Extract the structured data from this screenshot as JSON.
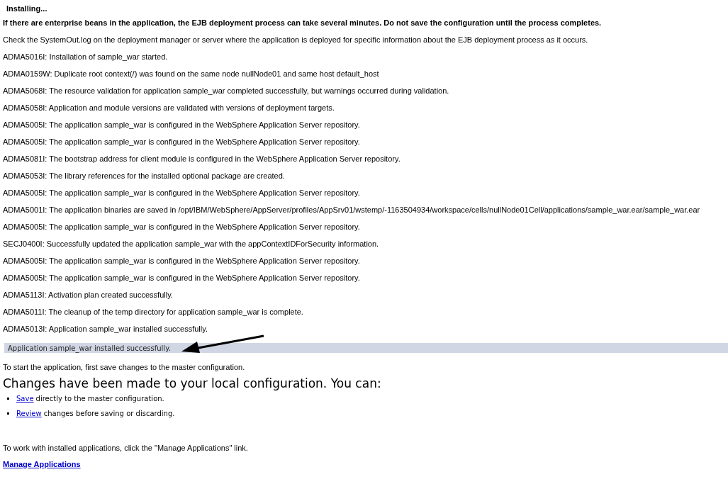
{
  "title": "Installing...",
  "warning": "If there are enterprise beans in the application, the EJB deployment process can take several minutes. Do not save the configuration until the process completes.",
  "hint": "Check the SystemOut.log on the deployment manager or server where the application is deployed for specific information about the EJB deployment process as it occurs.",
  "messages": [
    "ADMA5016I: Installation of sample_war started.",
    "ADMA0159W: Duplicate root context(/) was found on the same node nullNode01 and same host default_host",
    "ADMA5068I: The resource validation for application sample_war completed successfully, but warnings occurred during validation.",
    "ADMA5058I: Application and module versions are validated with versions of deployment targets.",
    "ADMA5005I: The application sample_war is configured in the WebSphere Application Server repository.",
    "ADMA5005I: The application sample_war is configured in the WebSphere Application Server repository.",
    "ADMA5081I: The bootstrap address for client module is configured in the WebSphere Application Server repository.",
    "ADMA5053I: The library references for the installed optional package are created.",
    "ADMA5005I: The application sample_war is configured in the WebSphere Application Server repository.",
    "ADMA5001I: The application binaries are saved in /opt/IBM/WebSphere/AppServer/profiles/AppSrv01/wstemp/-1163504934/workspace/cells/nullNode01Cell/applications/sample_war.ear/sample_war.ear",
    "ADMA5005I: The application sample_war is configured in the WebSphere Application Server repository.",
    "SECJ0400I: Successfully updated the application sample_war with the appContextIDForSecurity information.",
    "ADMA5005I: The application sample_war is configured in the WebSphere Application Server repository.",
    "ADMA5005I: The application sample_war is configured in the WebSphere Application Server repository.",
    "ADMA5113I: Activation plan created successfully.",
    "ADMA5011I: The cleanup of the temp directory for application sample_war is complete.",
    "ADMA5013I: Application sample_war installed successfully."
  ],
  "success_banner": "Application sample_war installed successfully.",
  "start_note": "To start the application, first save changes to the master configuration.",
  "changes_heading": "Changes have been made to your local configuration. You can:",
  "options": [
    {
      "link": "Save",
      "text": "directly to the master configuration."
    },
    {
      "link": "Review",
      "text": "changes before saving or discarding."
    }
  ],
  "manage_note": "To work with installed applications, click the \"Manage Applications\" link.",
  "manage_link": "Manage Applications"
}
